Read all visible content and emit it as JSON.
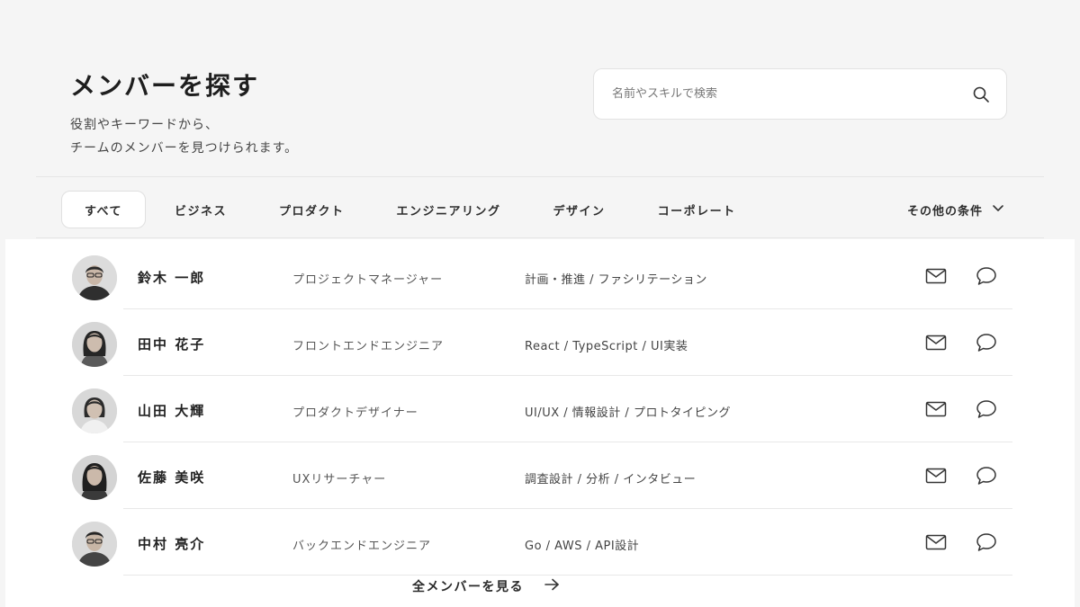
{
  "header": {
    "title": "メンバーを探す",
    "description_lines": [
      "役割やキーワードから、",
      "チームのメンバーを見つけられます。"
    ]
  },
  "search": {
    "placeholder": "名前やスキルで検索",
    "icon": "search-icon"
  },
  "tabs": [
    {
      "label": "すべて",
      "active": true
    },
    {
      "label": "ビジネス",
      "active": false
    },
    {
      "label": "プロダクト",
      "active": false
    },
    {
      "label": "エンジニアリング",
      "active": false
    },
    {
      "label": "デザイン",
      "active": false
    },
    {
      "label": "コーポレート",
      "active": false
    }
  ],
  "filter": {
    "label": "その他の条件",
    "icon": "chevron-down-icon"
  },
  "members": [
    {
      "name": "鈴木 一郎",
      "role": "プロジェクトマネージャー",
      "skills": "計画・推進 / ファシリテーション",
      "avatar": "male-glasses"
    },
    {
      "name": "田中 花子",
      "role": "フロントエンドエンジニア",
      "skills": "React / TypeScript / UI実装",
      "avatar": "female-long-hair"
    },
    {
      "name": "山田 大輝",
      "role": "プロダクトデザイナー",
      "skills": "UI/UX / 情報設計 / プロトタイピング",
      "avatar": "female-bob"
    },
    {
      "name": "佐藤 美咲",
      "role": "UXリサーチャー",
      "skills": "調査設計 / 分析 / インタビュー",
      "avatar": "female-long-hair"
    },
    {
      "name": "中村 亮介",
      "role": "バックエンドエンジニア",
      "skills": "Go / AWS / API設計",
      "avatar": "male-glasses"
    }
  ],
  "row_actions": {
    "mail_icon": "mail-icon",
    "chat_icon": "chat-bubble-icon"
  },
  "footer": {
    "view_all_label": "全メンバーを見る",
    "icon": "arrow-right-icon"
  },
  "colors": {
    "background": "#f5f5f5",
    "panel": "#ffffff",
    "text": "#2a2a2a",
    "muted": "#555555",
    "border": "#e6e6e6"
  }
}
